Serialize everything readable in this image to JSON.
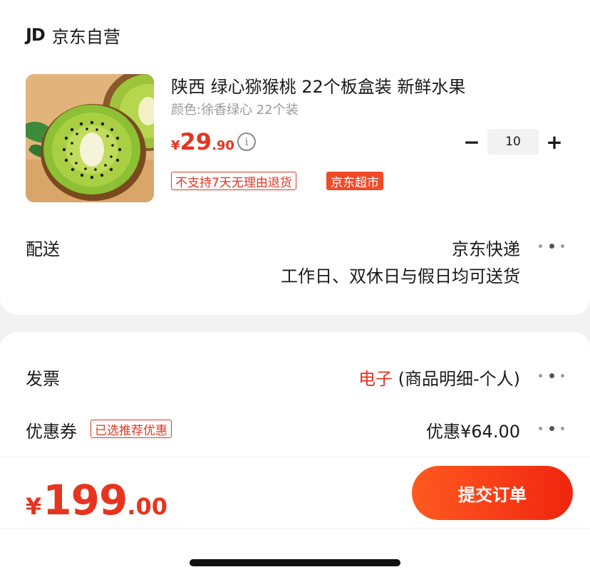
{
  "shop": {
    "logo": "JD",
    "name": "京东自营"
  },
  "product": {
    "title": "陕西 绿心猕猴桃 22个板盒装 新鲜水果",
    "spec": "颜色:徐香绿心 22个装",
    "price_symbol": "¥",
    "price_int": "29",
    "price_dec": ".90",
    "info_glyph": "i",
    "quantity": "10",
    "minus_label": "−",
    "plus_label": "+",
    "tag_no_return": "不支持7天无理由退货",
    "tag_market": "京东超市",
    "image_icon": "kiwi-fruit"
  },
  "delivery": {
    "label": "配送",
    "method": "京东快递",
    "note": "工作日、双休日与假日均可送货"
  },
  "invoice": {
    "label": "发票",
    "type": "电子",
    "detail": " (商品明细-个人)"
  },
  "coupon": {
    "label": "优惠券",
    "tag": "已选推荐优惠",
    "value": "优惠¥64.00"
  },
  "footer": {
    "total_symbol": "¥",
    "total_int": "199",
    "total_dec": ".00",
    "submit_label": "提交订单"
  },
  "colors": {
    "accent": "#e6341e",
    "button_start": "#ff5a1f",
    "button_end": "#f0250f",
    "background": "#f2f2f2"
  }
}
